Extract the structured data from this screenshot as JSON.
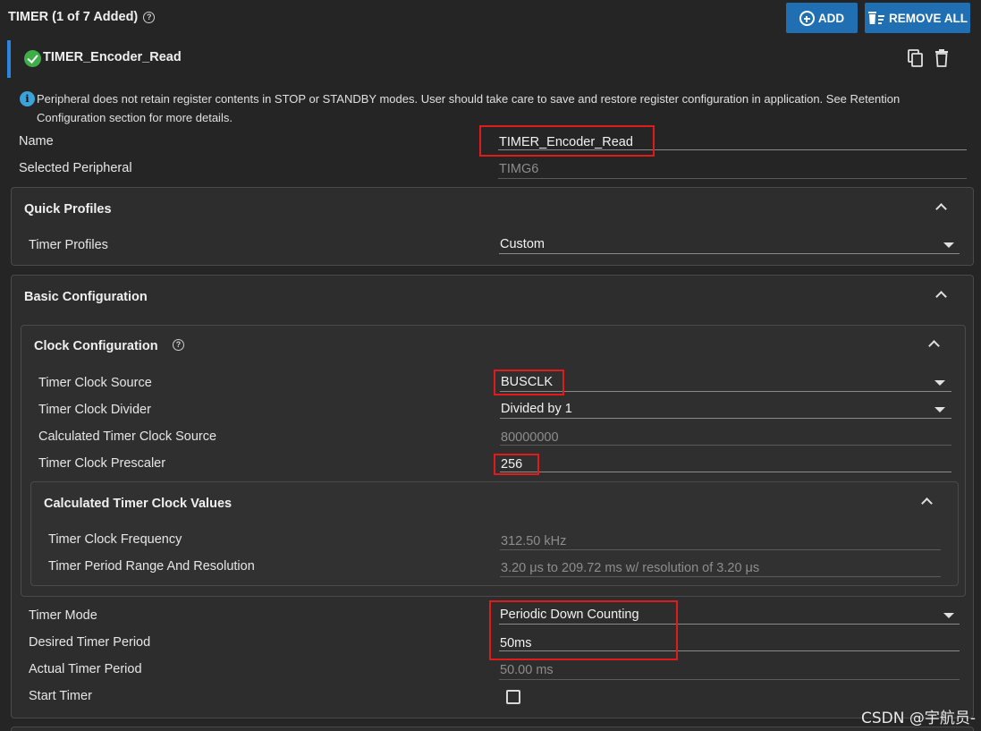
{
  "header": {
    "title": "TIMER (1 of 7 Added)",
    "add_label": "ADD",
    "remove_all_label": "REMOVE ALL"
  },
  "instance": {
    "name": "TIMER_Encoder_Read"
  },
  "info": {
    "text": "Peripheral does not retain register contents in STOP or STANDBY modes. User should take care to save and restore register configuration in application. See Retention Configuration section for more details."
  },
  "fields": {
    "name_label": "Name",
    "name_value": "TIMER_Encoder_Read",
    "selected_peripheral_label": "Selected Peripheral",
    "selected_peripheral_value": "TIMG6"
  },
  "quick_profiles": {
    "title": "Quick Profiles",
    "timer_profiles_label": "Timer Profiles",
    "timer_profiles_value": "Custom"
  },
  "basic_config": {
    "title": "Basic Configuration",
    "clock_config": {
      "title": "Clock Configuration",
      "clock_source_label": "Timer Clock Source",
      "clock_source_value": "BUSCLK",
      "clock_divider_label": "Timer Clock Divider",
      "clock_divider_value": "Divided by 1",
      "calc_clock_source_label": "Calculated Timer Clock Source",
      "calc_clock_source_value": "80000000",
      "prescaler_label": "Timer Clock Prescaler",
      "prescaler_value": "256",
      "calc_values": {
        "title": "Calculated Timer Clock Values",
        "freq_label": "Timer Clock Frequency",
        "freq_value": "312.50 kHz",
        "range_label": "Timer Period Range And Resolution",
        "range_value": "3.20 μs to 209.72 ms w/ resolution of 3.20 μs"
      }
    },
    "timer_mode_label": "Timer Mode",
    "timer_mode_value": "Periodic Down Counting",
    "desired_period_label": "Desired Timer Period",
    "desired_period_value": "50ms",
    "actual_period_label": "Actual Timer Period",
    "actual_period_value": "50.00 ms",
    "start_timer_label": "Start Timer"
  },
  "watermark": "CSDN @宇航员-",
  "colors": {
    "accent": "#1f6fb2",
    "instance_bar": "#2a85e0",
    "success": "#3fae49",
    "highlight": "#e01b1b"
  }
}
